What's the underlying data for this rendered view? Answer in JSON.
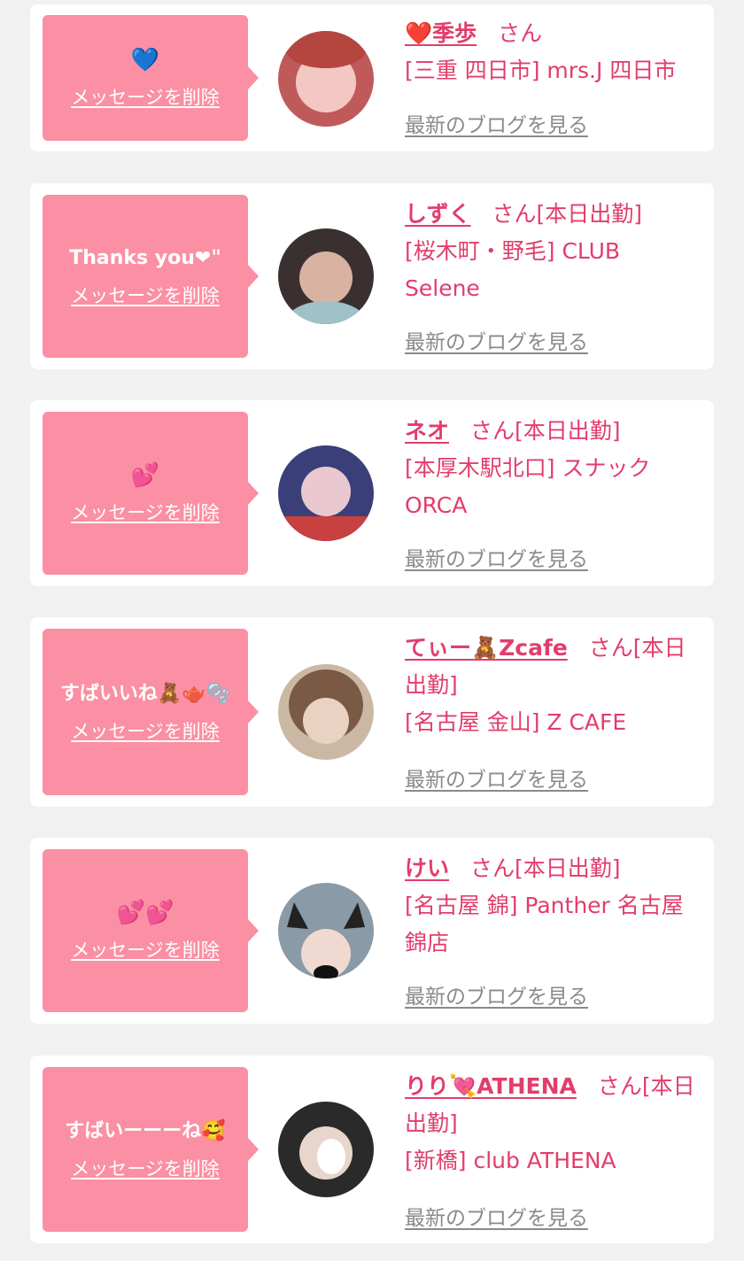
{
  "delete_label": "メッセージを削除",
  "blog_label": "最新のブログを見る",
  "messages": [
    {
      "message": "💙",
      "name": "❤️季歩",
      "suffix": "さん",
      "shop": "[三重 四日市] mrs.J 四日市",
      "avatar_colors": [
        "#f3c7c2",
        "#c05a5a"
      ]
    },
    {
      "message": "Thanks you❤\"",
      "name": "しずく",
      "suffix": "さん[本日出勤]",
      "shop": "[桜木町・野毛] CLUB Selene",
      "avatar_colors": [
        "#3a3030",
        "#d9b3a2"
      ]
    },
    {
      "message": "💕",
      "name": "ネオ",
      "suffix": "さん[本日出勤]",
      "shop": "[本厚木駅北口] スナック ORCA",
      "avatar_colors": [
        "#3a3f7a",
        "#c84040"
      ]
    },
    {
      "message": "すばいいね🧸🫖🫧",
      "name": "てぃー🧸Zcafe",
      "suffix": "さん[本日出勤]",
      "shop": "[名古屋 金山] Z CAFE",
      "avatar_colors": [
        "#7a5a44",
        "#e9d2c2"
      ]
    },
    {
      "message": "💕💕",
      "name": "けい",
      "suffix": "さん[本日出勤]",
      "shop": "[名古屋 錦] Panther 名古屋錦店",
      "avatar_colors": [
        "#8a9aa6",
        "#2a2a2a"
      ]
    },
    {
      "message": "すばいーーーね🥰",
      "name": "りり💘ATHENA",
      "suffix": "さん[本日出勤]",
      "shop": "[新橋] club ATHENA",
      "avatar_colors": [
        "#2a2a2a",
        "#e8d6cc"
      ]
    }
  ]
}
